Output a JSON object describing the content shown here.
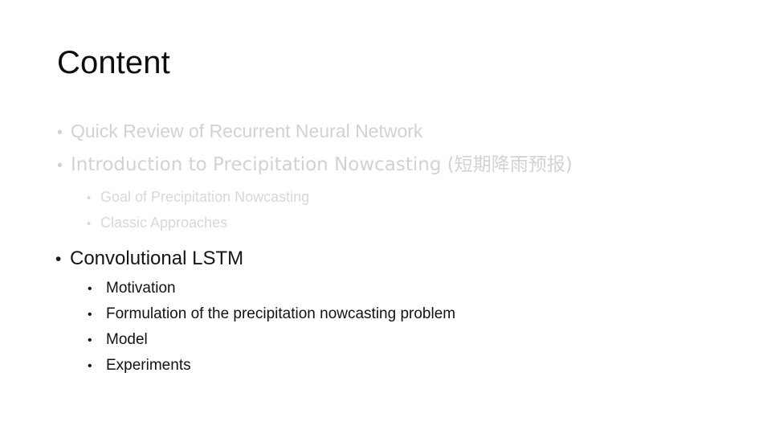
{
  "slide": {
    "title": "Content",
    "background_color": "#ffffff",
    "dim_text_color": "#d2d2d2",
    "dim_sub_text_color": "#d8d8d8",
    "active_text_color": "#151515",
    "title_color": "#0d0d0d",
    "bullet_glyph": "•"
  },
  "outline": {
    "dim_items": [
      {
        "label": "Quick Review of Recurrent Neural Network"
      },
      {
        "label": "Introduction to Precipitation Nowcasting (短期降雨预报)"
      }
    ],
    "dim_subitems": [
      {
        "label": "Goal of Precipitation Nowcasting"
      },
      {
        "label": "Classic Approaches"
      }
    ],
    "active_item": {
      "label": "Convolutional LSTM"
    },
    "active_subitems": [
      {
        "label": "Motivation"
      },
      {
        "label": "Formulation of the precipitation nowcasting problem"
      },
      {
        "label": "Model"
      },
      {
        "label": "Experiments"
      }
    ]
  }
}
